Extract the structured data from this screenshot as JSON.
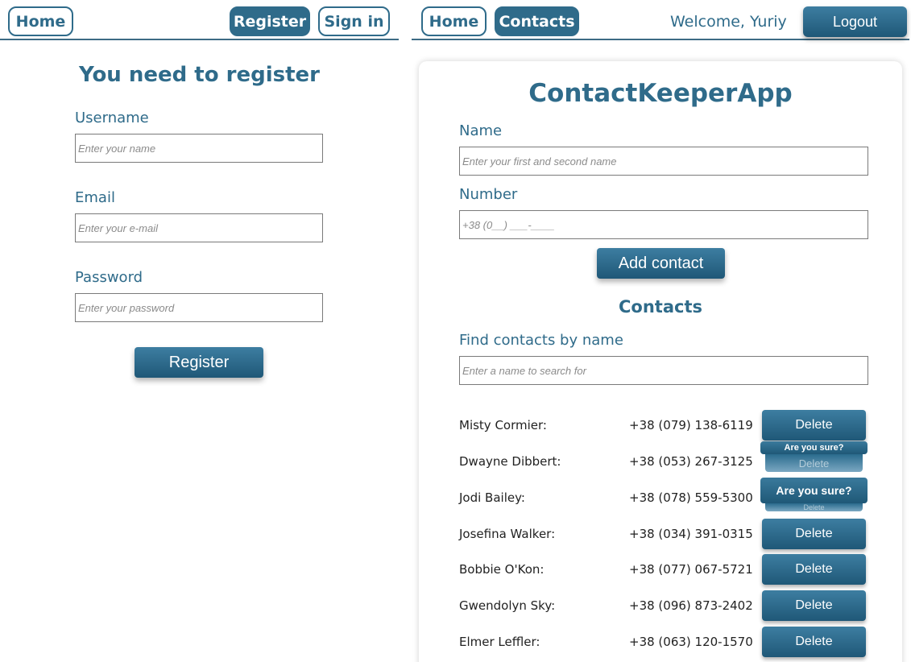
{
  "left": {
    "nav": {
      "home": "Home",
      "register": "Register",
      "signin": "Sign in"
    },
    "title": "You need to register",
    "username": {
      "label": "Username",
      "placeholder": "Enter your name"
    },
    "email": {
      "label": "Email",
      "placeholder": "Enter your e-mail"
    },
    "password": {
      "label": "Password",
      "placeholder": "Enter your password"
    },
    "submit": "Register"
  },
  "right": {
    "nav": {
      "home": "Home",
      "contacts": "Contacts",
      "welcome": "Welcome, Yuriy",
      "logout": "Logout"
    },
    "app_title": "ContactKeeperApp",
    "name": {
      "label": "Name",
      "placeholder": "Enter your first and second name"
    },
    "number": {
      "label": "Number",
      "placeholder": "+38 (0__) ___-____"
    },
    "add_button": "Add contact",
    "contacts_heading": "Contacts",
    "find": {
      "label": "Find contacts by name",
      "placeholder": "Enter a name to search for"
    },
    "confirm_text": "Are you sure?",
    "contacts": [
      {
        "name": "Misty Cormier:",
        "number": "+38 (079) 138-6119",
        "action": "Delete"
      },
      {
        "name": "Dwayne Dibbert:",
        "number": "+38 (053) 267-3125",
        "action": "Delete"
      },
      {
        "name": "Jodi Bailey:",
        "number": "+38 (078) 559-5300",
        "action": "Delete"
      },
      {
        "name": "Josefina Walker:",
        "number": "+38 (034) 391-0315",
        "action": "Delete"
      },
      {
        "name": "Bobbie O'Kon:",
        "number": "+38 (077) 067-5721",
        "action": "Delete"
      },
      {
        "name": "Gwendolyn Sky:",
        "number": "+38 (096) 873-2402",
        "action": "Delete"
      },
      {
        "name": "Elmer Leffler:",
        "number": "+38 (063) 120-1570",
        "action": "Delete"
      }
    ]
  },
  "colors": {
    "primary": "#2f6b8a",
    "button_top": "#3d7ea1",
    "button_bottom": "#1f5877"
  }
}
